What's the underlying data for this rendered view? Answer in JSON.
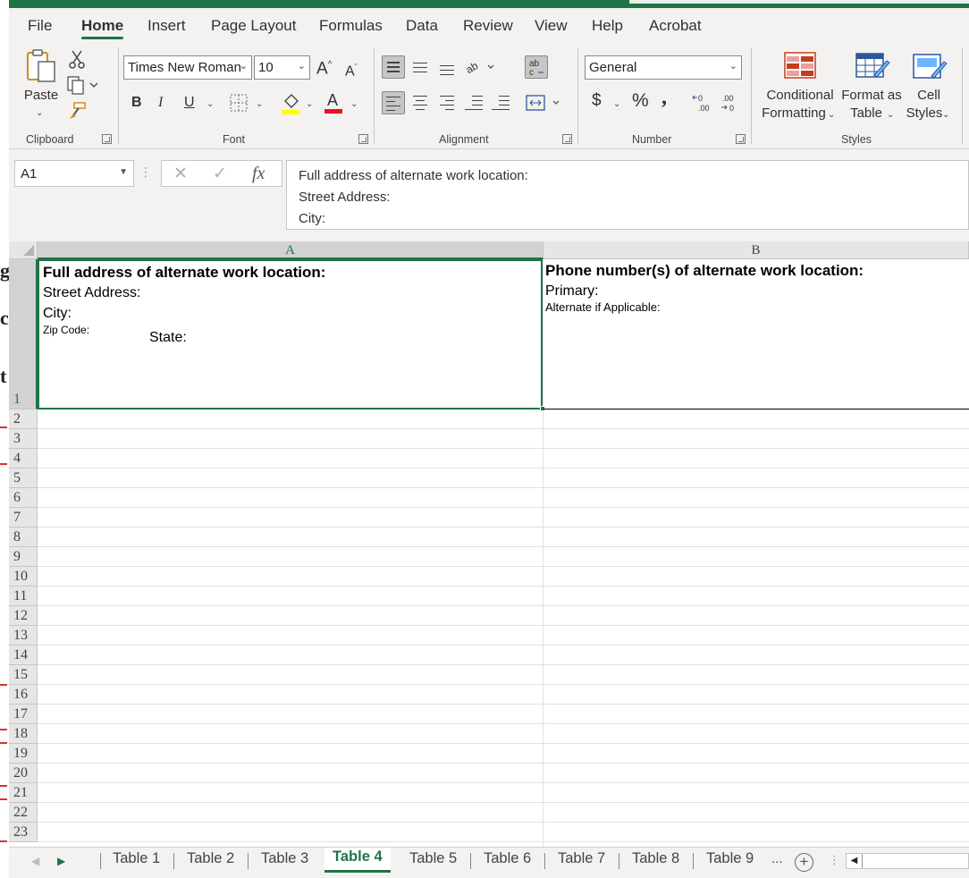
{
  "ribbon": {
    "tabs": [
      "File",
      "Home",
      "Insert",
      "Page Layout",
      "Formulas",
      "Data",
      "Review",
      "View",
      "Help",
      "Acrobat"
    ],
    "active_tab": "Home",
    "clipboard": {
      "paste_label": "Paste",
      "group_label": "Clipboard"
    },
    "font": {
      "font_name": "Times New Roman",
      "font_size": "10",
      "group_label": "Font",
      "bold": "B",
      "italic": "I",
      "underline": "U",
      "font_color": "#e81123",
      "highlight_color": "#ffff00"
    },
    "alignment": {
      "group_label": "Alignment"
    },
    "number": {
      "format": "General",
      "group_label": "Number",
      "currency": "$",
      "percent": "%",
      "comma": ",",
      "increase_decimal": "←0 .00",
      "decrease_decimal": ".00 →0"
    },
    "styles": {
      "group_label": "Styles",
      "conditional_formatting": [
        "Conditional",
        "Formatting"
      ],
      "format_as_table": [
        "Format as",
        "Table"
      ],
      "cell_styles": [
        "Cell",
        "Styles"
      ]
    }
  },
  "formula_bar": {
    "name_box": "A1",
    "fx": "fx",
    "content": [
      "Full address of alternate work location:",
      "Street Address:",
      "City:"
    ]
  },
  "sheet": {
    "columns": [
      "A",
      "B"
    ],
    "rows": [
      "1",
      "2",
      "3",
      "4",
      "5",
      "6",
      "7",
      "8",
      "9",
      "10",
      "11",
      "12",
      "13",
      "14",
      "15",
      "16",
      "17",
      "18",
      "19",
      "20",
      "21",
      "22",
      "23"
    ],
    "cell_a1": {
      "title": "Full address of alternate work location:",
      "street": "Street Address:",
      "city": "City:",
      "zip": "Zip Code:",
      "state": "State:"
    },
    "cell_b1": {
      "title": "Phone number(s) of alternate work location:",
      "primary": "Primary:",
      "alternate": "Alternate if Applicable:"
    }
  },
  "sheet_tabs": {
    "tabs": [
      "Table 1",
      "Table 2",
      "Table 3",
      "Table 4",
      "Table 5",
      "Table 6",
      "Table 7",
      "Table 8",
      "Table 9"
    ],
    "active": "Table 4",
    "more": "...",
    "add": "+"
  },
  "colors": {
    "accent": "#217346"
  }
}
